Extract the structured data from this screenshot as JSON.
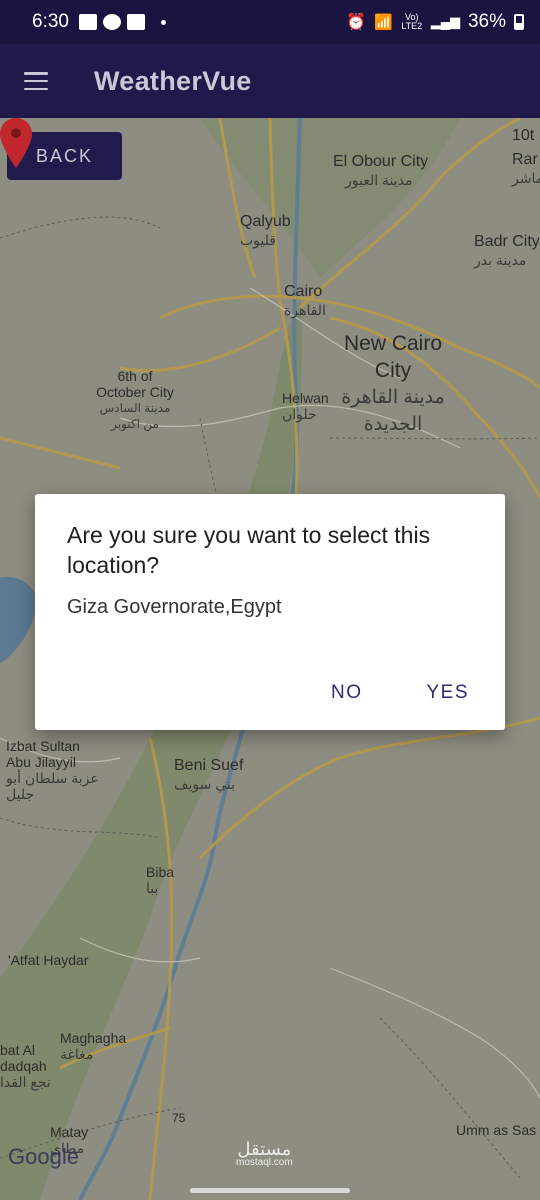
{
  "status_bar": {
    "time": "6:30",
    "network": "Vo) LTE2",
    "battery": "36%"
  },
  "app_bar": {
    "title": "WeatherVue"
  },
  "map": {
    "back_label": "BACK",
    "places": [
      {
        "name": "10t",
        "arabic": ""
      },
      {
        "name": "Rar",
        "arabic": "ماشر"
      },
      {
        "name": "El Obour City",
        "arabic": "مدينة العبور"
      },
      {
        "name": "Qalyub",
        "arabic": "قليوب"
      },
      {
        "name": "Badr City",
        "arabic": "مدينة بدر"
      },
      {
        "name": "Cairo",
        "arabic": "القاهرة"
      },
      {
        "name": "New Cairo City",
        "arabic": "مدينة القاهرة الجديدة"
      },
      {
        "name": "6th of October City",
        "arabic": "مدينة السادس من اكتوبر"
      },
      {
        "name": "Helwan",
        "arabic": "حلوان"
      },
      {
        "name": "Izbat Sultan Abu Jilayyil",
        "arabic": "عزبة سلطان أبو جليل"
      },
      {
        "name": "Beni Suef",
        "arabic": "بني سويف"
      },
      {
        "name": "Biba",
        "arabic": "ببا"
      },
      {
        "name": "'Atfat Haydar",
        "arabic": ""
      },
      {
        "name": "Maghagha",
        "arabic": "مغاغة"
      },
      {
        "name": "bat Al dadqah",
        "arabic": "نجع القدا"
      },
      {
        "name": "Matay",
        "arabic": "مطاي"
      },
      {
        "name": "Umm as Sas",
        "arabic": ""
      }
    ],
    "road_number": "75",
    "attribution": "Google",
    "watermark": "مستقل",
    "watermark_sub": "mostaql.com"
  },
  "dialog": {
    "title": "Are you sure you want to select this location?",
    "message": "Giza Governorate,Egypt",
    "no_label": "NO",
    "yes_label": "YES"
  },
  "colors": {
    "app_bar": "#1f1a4a",
    "status_bar": "#1b1440",
    "accent": "#2e2a72",
    "pin": "#c0282d"
  }
}
